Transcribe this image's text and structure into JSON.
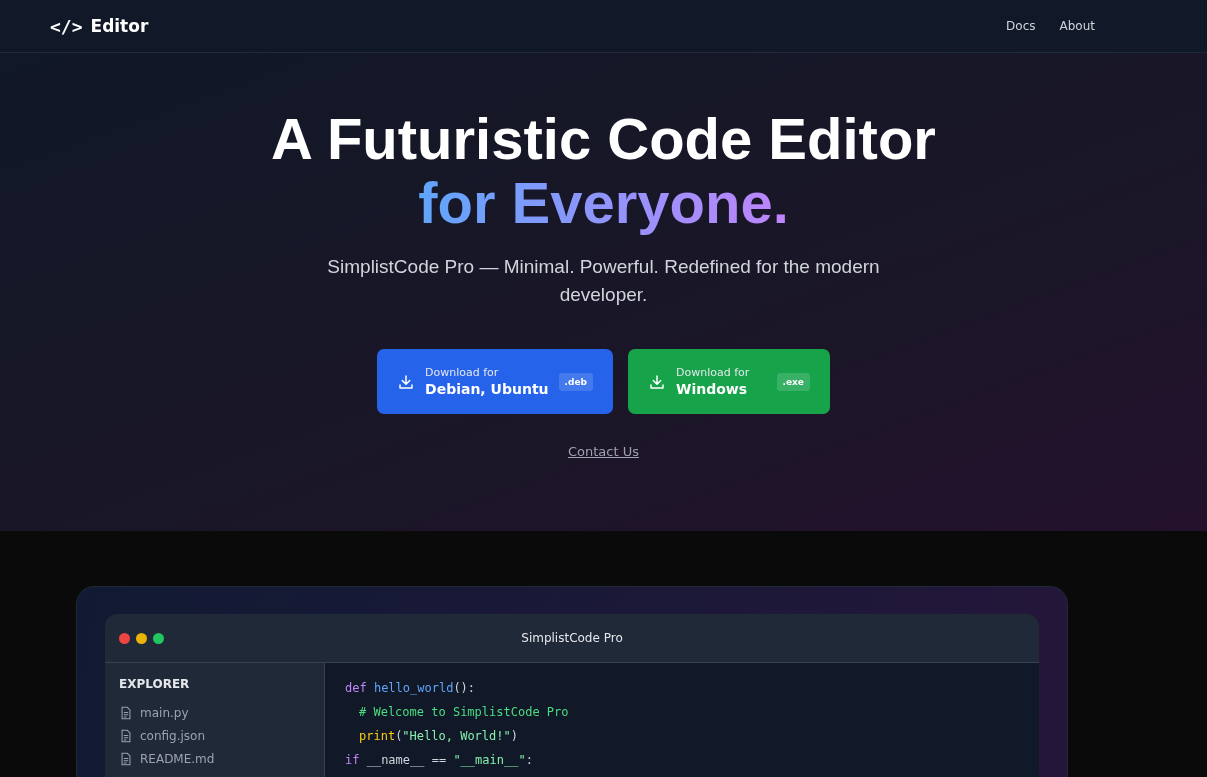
{
  "navbar": {
    "logo_icon": "</>",
    "brand": "Editor",
    "links": [
      "Docs",
      "About"
    ]
  },
  "hero": {
    "title": "A Futuristic Code Editor",
    "title_highlight": "for Everyone.",
    "subtitle": "SimplistCode Pro — Minimal. Powerful. Redefined for the modern developer.",
    "downloads": [
      {
        "label": "Download for",
        "platform": "Debian, Ubuntu",
        "badge": ".deb",
        "color": "#2563eb"
      },
      {
        "label": "Download for",
        "platform": "Windows",
        "badge": ".exe",
        "color": "#16a34a"
      }
    ],
    "contact_link": "Contact Us"
  },
  "editor": {
    "title": "SimplistCode Pro",
    "explorer_heading": "EXPLORER",
    "files": [
      "main.py",
      "config.json",
      "README.md"
    ],
    "code_lines": [
      {
        "indented": false,
        "tokens": [
          {
            "kind": "keyword",
            "text": "def "
          },
          {
            "kind": "function",
            "text": "hello_world"
          },
          {
            "kind": "plain",
            "text": "():"
          }
        ]
      },
      {
        "indented": true,
        "tokens": [
          {
            "kind": "comment",
            "text": "# Welcome to SimplistCode Pro"
          }
        ]
      },
      {
        "indented": true,
        "tokens": [
          {
            "kind": "builtin",
            "text": "print"
          },
          {
            "kind": "plain",
            "text": "("
          },
          {
            "kind": "string",
            "text": "\"Hello, World!\""
          },
          {
            "kind": "plain",
            "text": ")"
          }
        ]
      },
      {
        "indented": false,
        "tokens": [
          {
            "kind": "keyword",
            "text": "if "
          },
          {
            "kind": "plain",
            "text": "__name__ == "
          },
          {
            "kind": "string",
            "text": "\"__main__\""
          },
          {
            "kind": "plain",
            "text": ":"
          }
        ]
      }
    ]
  }
}
